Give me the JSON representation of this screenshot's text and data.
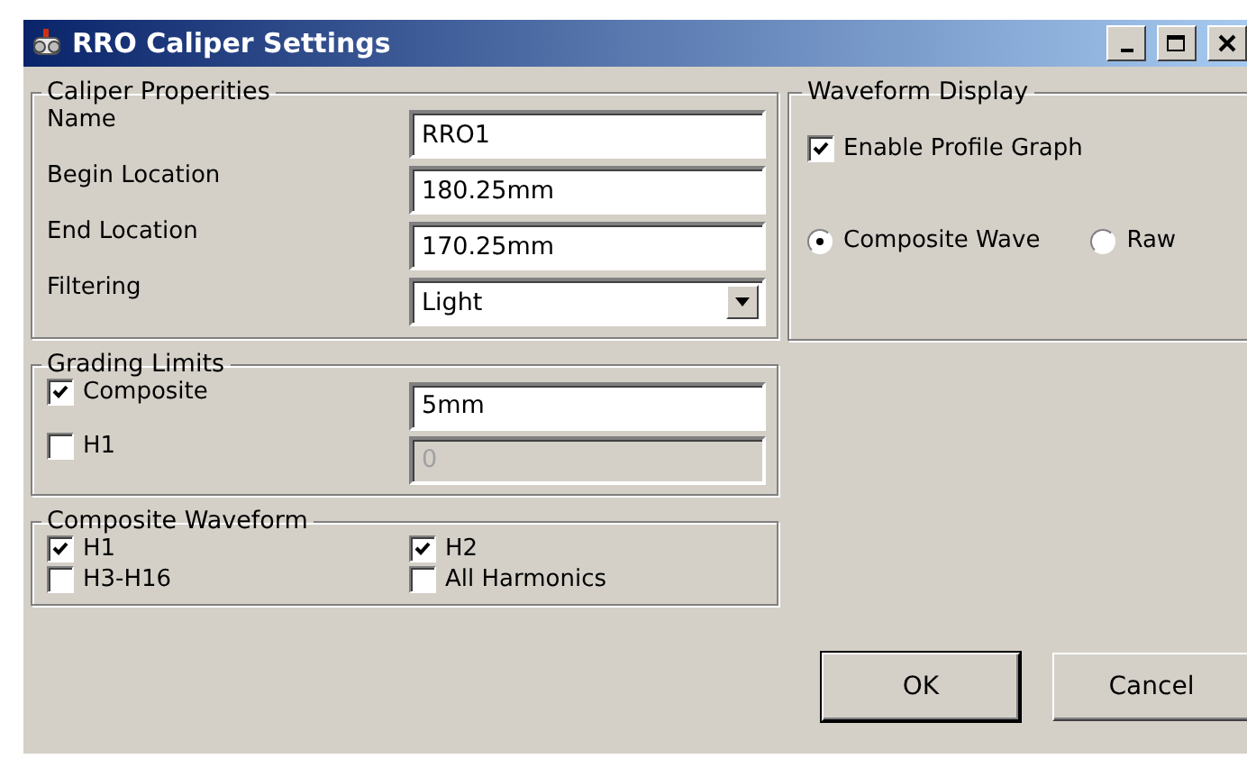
{
  "window": {
    "title": "RRO Caliper Settings"
  },
  "caliper_properties": {
    "title": "Caliper Properities",
    "fields": [
      {
        "label": "Name",
        "value": "RRO1",
        "kind": "text"
      },
      {
        "label": "Begin Location",
        "value": "180.25mm",
        "kind": "text"
      },
      {
        "label": "End Location",
        "value": "170.25mm",
        "kind": "text"
      },
      {
        "label": "Filtering",
        "value": "Light",
        "kind": "dropdown"
      }
    ]
  },
  "grading_limits": {
    "title": "Grading Limits",
    "rows": [
      {
        "label": "Composite",
        "checked": true,
        "value": "5mm",
        "disabled": false
      },
      {
        "label": "H1",
        "checked": false,
        "value": "0",
        "disabled": true
      }
    ]
  },
  "composite_waveform": {
    "title": "Composite Waveform",
    "options": [
      {
        "label": "H1",
        "checked": true
      },
      {
        "label": "H2",
        "checked": true
      },
      {
        "label": "H3-H16",
        "checked": false
      },
      {
        "label": "All Harmonics",
        "checked": false
      }
    ]
  },
  "waveform_display": {
    "title": "Waveform Display",
    "enable_profile_graph": {
      "label": "Enable Profile Graph",
      "checked": true
    },
    "modes": [
      {
        "label": "Composite Wave",
        "selected": true
      },
      {
        "label": "Raw",
        "selected": false
      }
    ]
  },
  "buttons": [
    {
      "label": "OK",
      "default": true
    },
    {
      "label": "Cancel",
      "default": false
    }
  ]
}
